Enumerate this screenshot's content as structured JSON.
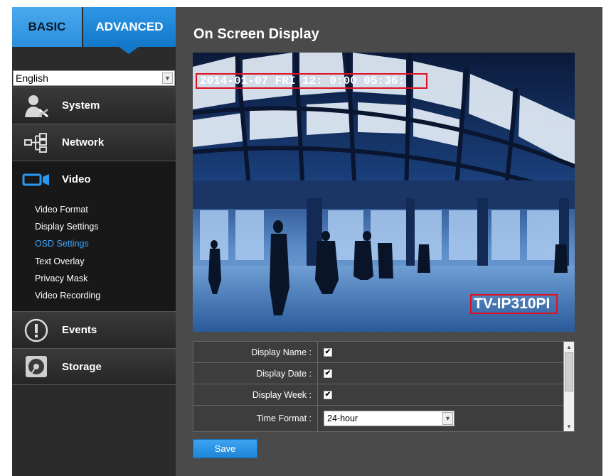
{
  "tabs": {
    "basic": "BASIC",
    "advanced": "ADVANCED"
  },
  "language": {
    "selected": "English"
  },
  "nav": {
    "system": "System",
    "network": "Network",
    "video": "Video",
    "events": "Events",
    "storage": "Storage"
  },
  "video_subnav": [
    "Video Format",
    "Display Settings",
    "OSD Settings",
    "Text Overlay",
    "Privacy Mask",
    "Video Recording"
  ],
  "page": {
    "title": "On Screen Display"
  },
  "preview": {
    "osd_date": "2014-01-07 FRI 12: 0:00 05:36:",
    "osd_name": "TV-IP310PI"
  },
  "settings": {
    "display_name_label": "Display Name :",
    "display_name_checked": true,
    "display_date_label": "Display Date :",
    "display_date_checked": true,
    "display_week_label": "Display Week :",
    "display_week_checked": true,
    "time_format_label": "Time Format :",
    "time_format_value": "24-hour"
  },
  "actions": {
    "save": "Save"
  },
  "colors": {
    "accent": "#1f86d8",
    "sidebar_bg": "#2b2b2b",
    "main_bg": "#4a4a4a",
    "active_link": "#3ea7ff",
    "osd_box": "#e01020"
  },
  "icons": {
    "system": "user-tools-icon",
    "network": "network-tree-icon",
    "video": "video-camera-icon",
    "events": "alert-icon",
    "storage": "disk-icon"
  }
}
